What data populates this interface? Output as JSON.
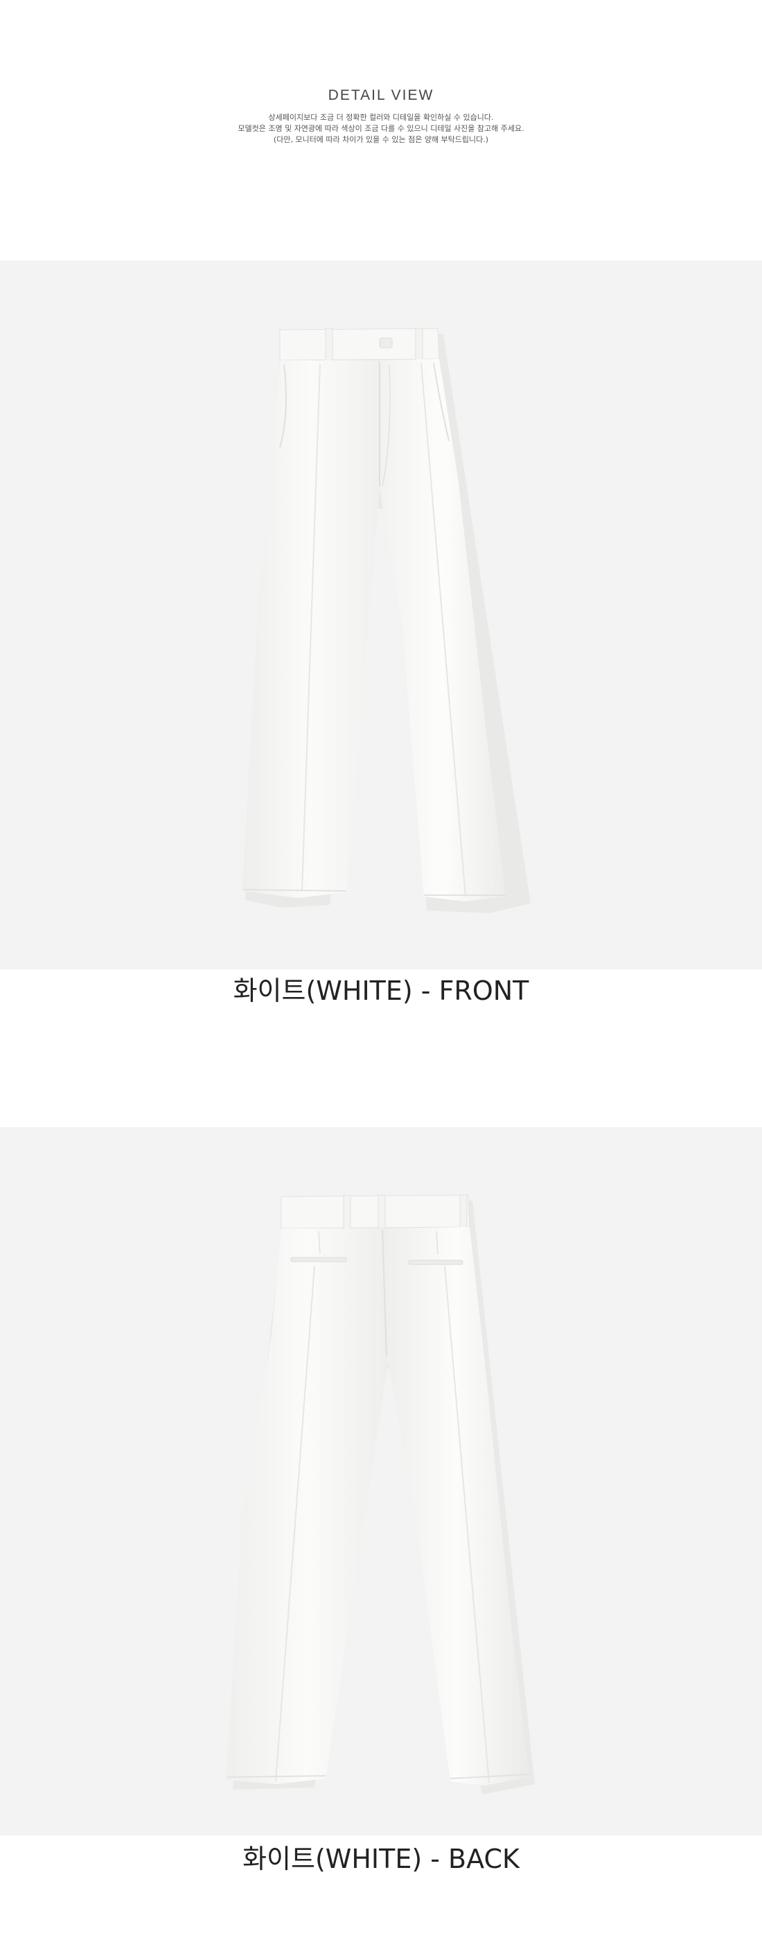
{
  "header": {
    "title": "DETAIL VIEW",
    "notes": [
      "상세페이지보다 조금 더 정확한 컬러와 디테일을 확인하실 수 있습니다.",
      "모델컷은 조명 및 자연광에 따라 색상이 조금 다를 수 있으니 디테일 사진을 참고해 주세요.",
      "(다만, 모니터에 따라 차이가 있을 수 있는 점은 양해 부탁드립니다.)"
    ]
  },
  "views": [
    {
      "caption": "화이트(WHITE) - FRONT",
      "image": "white-pants-front-photo"
    },
    {
      "caption": "화이트(WHITE) - BACK",
      "image": "white-pants-back-photo"
    }
  ],
  "colors": {
    "panel_background": "#f3f3f3",
    "garment": "#f7f7f5"
  }
}
